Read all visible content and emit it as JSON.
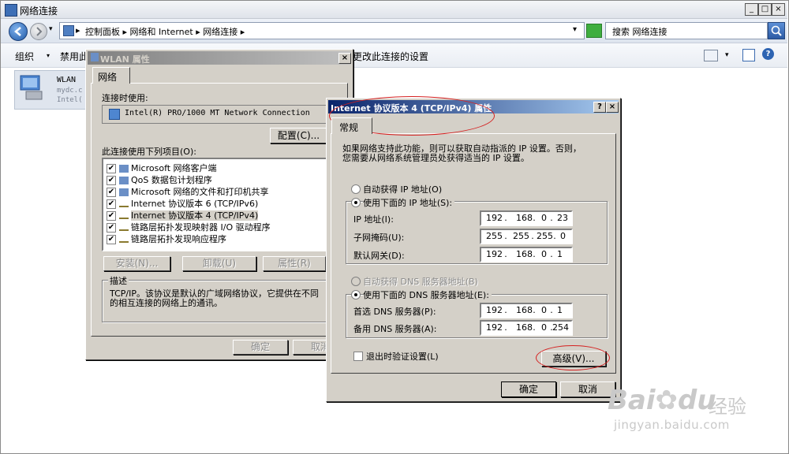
{
  "window": {
    "title": "网络连接",
    "breadcrumb": [
      "控制面板",
      "网络和 Internet",
      "网络连接"
    ],
    "search_placeholder": "搜索 网络连接",
    "toolbar": {
      "organize": "组织",
      "disable": "禁用此",
      "change_settings": "更改此连接的设置"
    }
  },
  "connection_item": {
    "name": "WLAN",
    "line2": "mydc.c",
    "line3": "Intel("
  },
  "wlan_dialog": {
    "title": "WLAN 属性",
    "tab": "网络",
    "connect_using_label": "连接时使用:",
    "adapter": "Intel(R) PRO/1000 MT Network Connection",
    "configure_button": "配置(C)...",
    "items_label": "此连接使用下列项目(O):",
    "items": [
      "Microsoft 网络客户端",
      "QoS 数据包计划程序",
      "Microsoft 网络的文件和打印机共享",
      "Internet 协议版本 6 (TCP/IPv6)",
      "Internet 协议版本 4 (TCP/IPv4)",
      "链路层拓扑发现映射器 I/O 驱动程序",
      "链路层拓扑发现响应程序"
    ],
    "install_button": "安装(N)...",
    "uninstall_button": "卸载(U)",
    "properties_button": "属性(R)",
    "description_label": "描述",
    "description_line1": "TCP/IP。该协议是默认的广域网络协议，它提供在不同",
    "description_line2": "的相互连接的网络上的通讯。",
    "ok_button": "确定",
    "cancel_button": "取消"
  },
  "ipv4_dialog": {
    "title": "Internet 协议版本 4 (TCP/IPv4) 属性",
    "help_glyph": "?",
    "close_glyph": "×",
    "tab": "常规",
    "intro_line1": "如果网络支持此功能，则可以获取自动指派的 IP 设置。否则，",
    "intro_line2": "您需要从网络系统管理员处获得适当的 IP 设置。",
    "auto_ip": "自动获得 IP 地址(O)",
    "manual_ip": "使用下面的 IP 地址(S):",
    "ip_label": "IP 地址(I):",
    "ip": [
      "192",
      "168",
      "0",
      "23"
    ],
    "mask_label": "子网掩码(U):",
    "mask": [
      "255",
      "255",
      "255",
      "0"
    ],
    "gateway_label": "默认网关(D):",
    "gateway": [
      "192",
      "168",
      "0",
      "1"
    ],
    "auto_dns": "自动获得 DNS 服务器地址(B)",
    "manual_dns": "使用下面的 DNS 服务器地址(E):",
    "dns1_label": "首选 DNS 服务器(P):",
    "dns1": [
      "192",
      "168",
      "0",
      "1"
    ],
    "dns2_label": "备用 DNS 服务器(A):",
    "dns2": [
      "192",
      "168",
      "0",
      "254"
    ],
    "validate_label": "退出时验证设置(L)",
    "advanced_button": "高级(V)...",
    "ok_button": "确定",
    "cancel_button": "取消"
  },
  "watermark": {
    "brand": "Bai",
    "brand2": "du",
    "cn": "经验",
    "url": "jingyan.baidu.com"
  },
  "colors": {
    "title_active": "#0a246a",
    "dialog_face": "#d4d0c8",
    "annotation": "#d52020"
  }
}
